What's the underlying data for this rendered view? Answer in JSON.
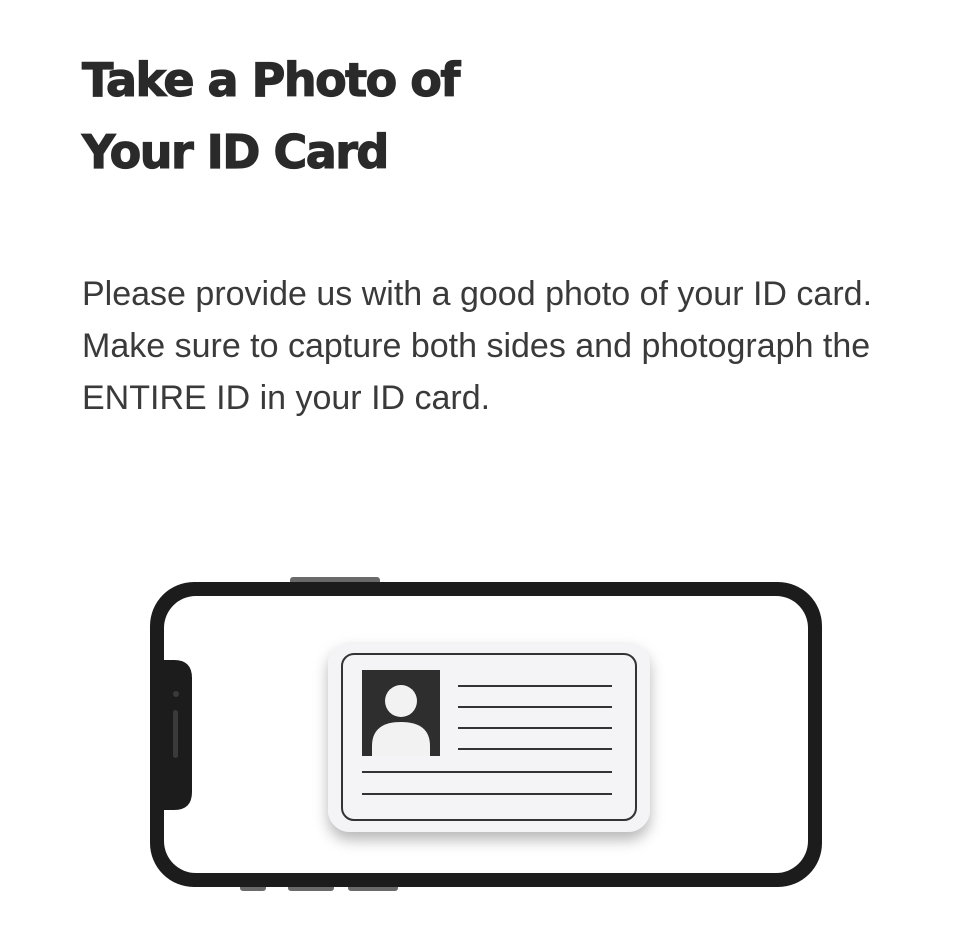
{
  "header": {
    "title_line1": "Take a Photo of",
    "title_line2": "Your ID Card"
  },
  "body": {
    "description": "Please provide us with a good photo of your ID card. Make sure to capture both sides and photograph the ENTIRE ID in your ID card."
  },
  "illustration": {
    "icons": [
      "phone-icon",
      "id-card-icon",
      "user-silhouette-icon"
    ],
    "colors": {
      "phone_frame": "#1c1c1c",
      "phone_screen": "#ffffff",
      "card_fill": "#f4f4f6",
      "card_border": "#333333",
      "photo_box": "#2e2e2e",
      "silhouette": "#f2f2f2"
    }
  }
}
